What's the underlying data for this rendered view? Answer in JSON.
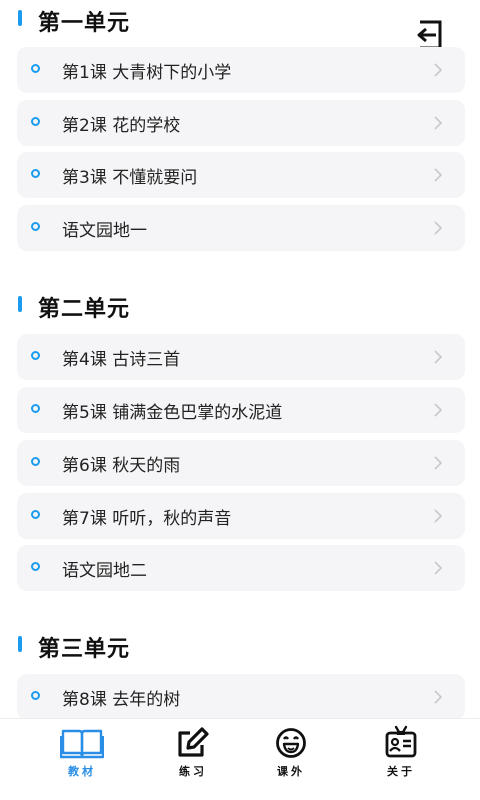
{
  "header": {
    "exit_icon": "logout-icon"
  },
  "units": [
    {
      "title": "第一单元",
      "lessons": [
        "第1课  大青树下的小学",
        "第2课  花的学校",
        "第3课  不懂就要问",
        "语文园地一"
      ]
    },
    {
      "title": "第二单元",
      "lessons": [
        "第4课  古诗三首",
        "第5课  铺满金色巴掌的水泥道",
        "第6课  秋天的雨",
        "第7课  听听，秋的声音",
        "语文园地二"
      ]
    },
    {
      "title": "第三单元",
      "lessons": [
        "第8课  去年的树"
      ]
    }
  ],
  "tabs": [
    {
      "label": "教材",
      "icon": "book-icon",
      "active": true
    },
    {
      "label": "练习",
      "icon": "edit-icon",
      "active": false
    },
    {
      "label": "课外",
      "icon": "smile-icon",
      "active": false
    },
    {
      "label": "关于",
      "icon": "id-badge-icon",
      "active": false
    }
  ],
  "colors": {
    "accent": "#1a9cf0",
    "active_tab": "#2a8ee6",
    "card_bg": "#f5f5f7"
  }
}
